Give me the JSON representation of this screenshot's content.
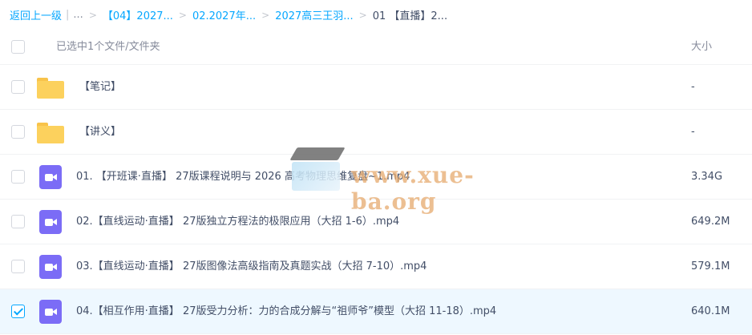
{
  "breadcrumb": {
    "back": "返回上一级",
    "ellipsis": "...",
    "items": [
      "【04】2027...",
      "02.2027年...",
      "2027高三王羽..."
    ],
    "current": "01 【直播】2..."
  },
  "header": {
    "selection_text": "已选中1个文件/文件夹",
    "size_header": "大小"
  },
  "files": [
    {
      "type": "folder",
      "name": "【笔记】",
      "size": "-",
      "checked": false
    },
    {
      "type": "folder",
      "name": "【讲义】",
      "size": "-",
      "checked": false
    },
    {
      "type": "video",
      "name": "01. 【开班课·直播】 27版课程说明与 2026 高考物理思维复盘~1.mp4",
      "size": "3.34G",
      "checked": false
    },
    {
      "type": "video",
      "name": "02.【直线运动·直播】 27版独立方程法的极限应用（大招 1-6）.mp4",
      "size": "649.2M",
      "checked": false
    },
    {
      "type": "video",
      "name": "03.【直线运动·直播】 27版图像法高级指南及真题实战（大招 7-10）.mp4",
      "size": "579.1M",
      "checked": false
    },
    {
      "type": "video",
      "name": "04.【相互作用·直播】 27版受力分析：力的合成分解与“祖师爷”模型（大招 11-18）.mp4",
      "size": "640.1M",
      "checked": true
    }
  ],
  "watermark": {
    "text": "www.xue-ba.org"
  },
  "colors": {
    "accent": "#06a7ff",
    "folder": "#fcd15d",
    "video": "#7b6cf6",
    "selected_row": "#eef8ff"
  }
}
